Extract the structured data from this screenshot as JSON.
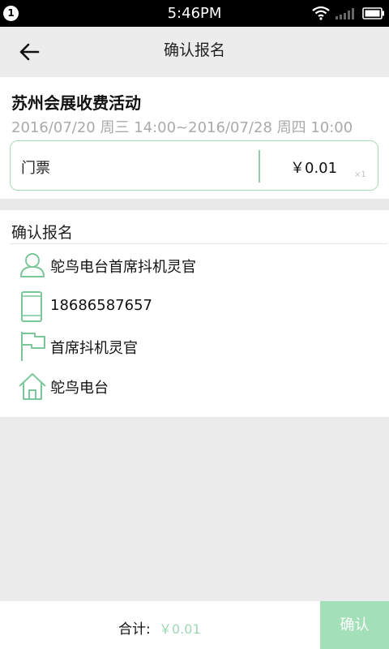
{
  "status": {
    "badge": "1",
    "time": "5:46PM"
  },
  "header": {
    "title": "确认报名"
  },
  "event": {
    "title": "苏州会展收费活动",
    "time": "2016/07/20 周三 14:00~2016/07/28 周四 10:00",
    "ticket": {
      "name": "门票",
      "price": "￥0.01",
      "qty": "×1"
    }
  },
  "confirm": {
    "header": "确认报名",
    "rows": [
      {
        "icon": "person-icon",
        "text": "鸵鸟电台首席抖机灵官"
      },
      {
        "icon": "phone-icon",
        "text": "18686587657"
      },
      {
        "icon": "flag-icon",
        "text": "首席抖机灵官"
      },
      {
        "icon": "home-icon",
        "text": "鸵鸟电台"
      }
    ]
  },
  "footer": {
    "total_label": "合计:",
    "total_value": "￥0.01",
    "confirm_label": "确认"
  },
  "colors": {
    "accent": "#a3dfb9",
    "icon_green": "#7cc79a",
    "ticket_border": "#a6dcb9"
  }
}
